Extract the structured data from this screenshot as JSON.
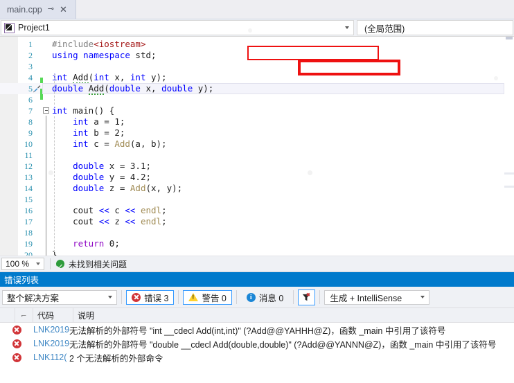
{
  "tab": {
    "title": "main.cpp",
    "pin_icon": "pin-icon",
    "close_icon": "close-icon"
  },
  "navbar": {
    "project": "Project1",
    "scope": "(全局范围)"
  },
  "editor": {
    "lines": [
      {
        "n": "1",
        "tokens": [
          {
            "t": "#include",
            "c": "pp"
          },
          {
            "t": "<iostream>",
            "c": "hdr"
          }
        ]
      },
      {
        "n": "2",
        "tokens": [
          {
            "t": "using",
            "c": "kw"
          },
          {
            "t": " ",
            "c": "id"
          },
          {
            "t": "namespace",
            "c": "kw"
          },
          {
            "t": " std;",
            "c": "id"
          }
        ]
      },
      {
        "n": "3",
        "tokens": []
      },
      {
        "n": "4",
        "tokens": [
          {
            "t": "int",
            "c": "kw"
          },
          {
            "t": " ",
            "c": "id"
          },
          {
            "t": "Add",
            "c": "id sq"
          },
          {
            "t": "(",
            "c": "op"
          },
          {
            "t": "int",
            "c": "kw"
          },
          {
            "t": " x, ",
            "c": "id"
          },
          {
            "t": "int",
            "c": "kw"
          },
          {
            "t": " y);",
            "c": "id"
          }
        ]
      },
      {
        "n": "5",
        "tokens": [
          {
            "t": "double",
            "c": "kw"
          },
          {
            "t": " ",
            "c": "id"
          },
          {
            "t": "Add",
            "c": "id sq"
          },
          {
            "t": "(",
            "c": "op"
          },
          {
            "t": "double",
            "c": "kw"
          },
          {
            "t": " x, ",
            "c": "id"
          },
          {
            "t": "double",
            "c": "kw"
          },
          {
            "t": " y);",
            "c": "id"
          }
        ]
      },
      {
        "n": "6",
        "tokens": []
      },
      {
        "n": "7",
        "tokens": [
          {
            "t": "int",
            "c": "kw"
          },
          {
            "t": " ",
            "c": "id"
          },
          {
            "t": "main",
            "c": "id"
          },
          {
            "t": "() {",
            "c": "op"
          }
        ]
      },
      {
        "n": "8",
        "tokens": [
          {
            "t": "    ",
            "c": "id"
          },
          {
            "t": "int",
            "c": "kw"
          },
          {
            "t": " a = ",
            "c": "id"
          },
          {
            "t": "1",
            "c": "num"
          },
          {
            "t": ";",
            "c": "op"
          }
        ]
      },
      {
        "n": "9",
        "tokens": [
          {
            "t": "    ",
            "c": "id"
          },
          {
            "t": "int",
            "c": "kw"
          },
          {
            "t": " b = ",
            "c": "id"
          },
          {
            "t": "2",
            "c": "num"
          },
          {
            "t": ";",
            "c": "op"
          }
        ]
      },
      {
        "n": "10",
        "tokens": [
          {
            "t": "    ",
            "c": "id"
          },
          {
            "t": "int",
            "c": "kw"
          },
          {
            "t": " c = ",
            "c": "id"
          },
          {
            "t": "Add",
            "c": "fn"
          },
          {
            "t": "(a, b);",
            "c": "id"
          }
        ]
      },
      {
        "n": "11",
        "tokens": []
      },
      {
        "n": "12",
        "tokens": [
          {
            "t": "    ",
            "c": "id"
          },
          {
            "t": "double",
            "c": "kw"
          },
          {
            "t": " x = ",
            "c": "id"
          },
          {
            "t": "3.1",
            "c": "num"
          },
          {
            "t": ";",
            "c": "op"
          }
        ]
      },
      {
        "n": "13",
        "tokens": [
          {
            "t": "    ",
            "c": "id"
          },
          {
            "t": "double",
            "c": "kw"
          },
          {
            "t": " y = ",
            "c": "id"
          },
          {
            "t": "4.2",
            "c": "num"
          },
          {
            "t": ";",
            "c": "op"
          }
        ]
      },
      {
        "n": "14",
        "tokens": [
          {
            "t": "    ",
            "c": "id"
          },
          {
            "t": "double",
            "c": "kw"
          },
          {
            "t": " z = ",
            "c": "id"
          },
          {
            "t": "Add",
            "c": "fn"
          },
          {
            "t": "(x, y);",
            "c": "id"
          }
        ]
      },
      {
        "n": "15",
        "tokens": []
      },
      {
        "n": "16",
        "tokens": [
          {
            "t": "    cout ",
            "c": "id"
          },
          {
            "t": "<<",
            "c": "kw"
          },
          {
            "t": " c ",
            "c": "id"
          },
          {
            "t": "<<",
            "c": "kw"
          },
          {
            "t": " ",
            "c": "id"
          },
          {
            "t": "endl",
            "c": "fn"
          },
          {
            "t": ";",
            "c": "op"
          }
        ]
      },
      {
        "n": "17",
        "tokens": [
          {
            "t": "    cout ",
            "c": "id"
          },
          {
            "t": "<<",
            "c": "kw"
          },
          {
            "t": " z ",
            "c": "id"
          },
          {
            "t": "<<",
            "c": "kw"
          },
          {
            "t": " ",
            "c": "id"
          },
          {
            "t": "endl",
            "c": "fn"
          },
          {
            "t": ";",
            "c": "op"
          }
        ]
      },
      {
        "n": "18",
        "tokens": []
      },
      {
        "n": "19",
        "tokens": [
          {
            "t": "    ",
            "c": "id"
          },
          {
            "t": "return",
            "c": "ctl"
          },
          {
            "t": " ",
            "c": "id"
          },
          {
            "t": "0",
            "c": "num"
          },
          {
            "t": ";",
            "c": "op"
          }
        ]
      },
      {
        "n": "20",
        "tokens": [
          {
            "t": "}",
            "c": "op"
          }
        ]
      }
    ],
    "current_line": 5,
    "changed_lines": [
      4,
      5
    ],
    "quickaction_line": 5,
    "quickaction_icon": "screwdriver-icon",
    "collapse_line": 7,
    "collapse_icon": "collapse-minus-icon"
  },
  "status": {
    "zoom": "100 %",
    "ok_icon": "check-circle-icon",
    "message": "未找到相关问题"
  },
  "panel": {
    "title": "错误列表",
    "scope_filter": "整个解决方案",
    "counters": [
      {
        "icon": "error-icon",
        "label": "错误 3",
        "active": true
      },
      {
        "icon": "warning-icon",
        "label": "警告 0",
        "active": true
      },
      {
        "icon": "info-icon",
        "label": "消息 0",
        "active": true
      }
    ],
    "filter_icon": "clear-filter-icon",
    "build_filter": "生成 + IntelliSense",
    "columns": {
      "select": "",
      "sort": "sort-indicator-icon",
      "code": "代码",
      "description": "说明"
    },
    "rows": [
      {
        "icon": "error-icon",
        "code": "LNK2019",
        "description": "无法解析的外部符号 \"int __cdecl Add(int,int)\" (?Add@@YAHHH@Z)，函数 _main 中引用了该符号"
      },
      {
        "icon": "error-icon",
        "code": "LNK2019",
        "description": "无法解析的外部符号 \"double __cdecl Add(double,double)\" (?Add@@YANNN@Z)，函数 _main 中引用了该符号"
      },
      {
        "icon": "error-icon",
        "code": "LNK112(",
        "description": "2 个无法解析的外部命令"
      }
    ],
    "annotations": [
      {
        "name": "annotation-box-mangled-name-1"
      },
      {
        "name": "annotation-box-mangled-name-2"
      }
    ]
  },
  "colors": {
    "accent": "#007acc",
    "error": "#d13438",
    "warning": "#ffd22e",
    "info": "#1a86d6",
    "annotation": "#ee1111",
    "changebar": "#57d957"
  }
}
